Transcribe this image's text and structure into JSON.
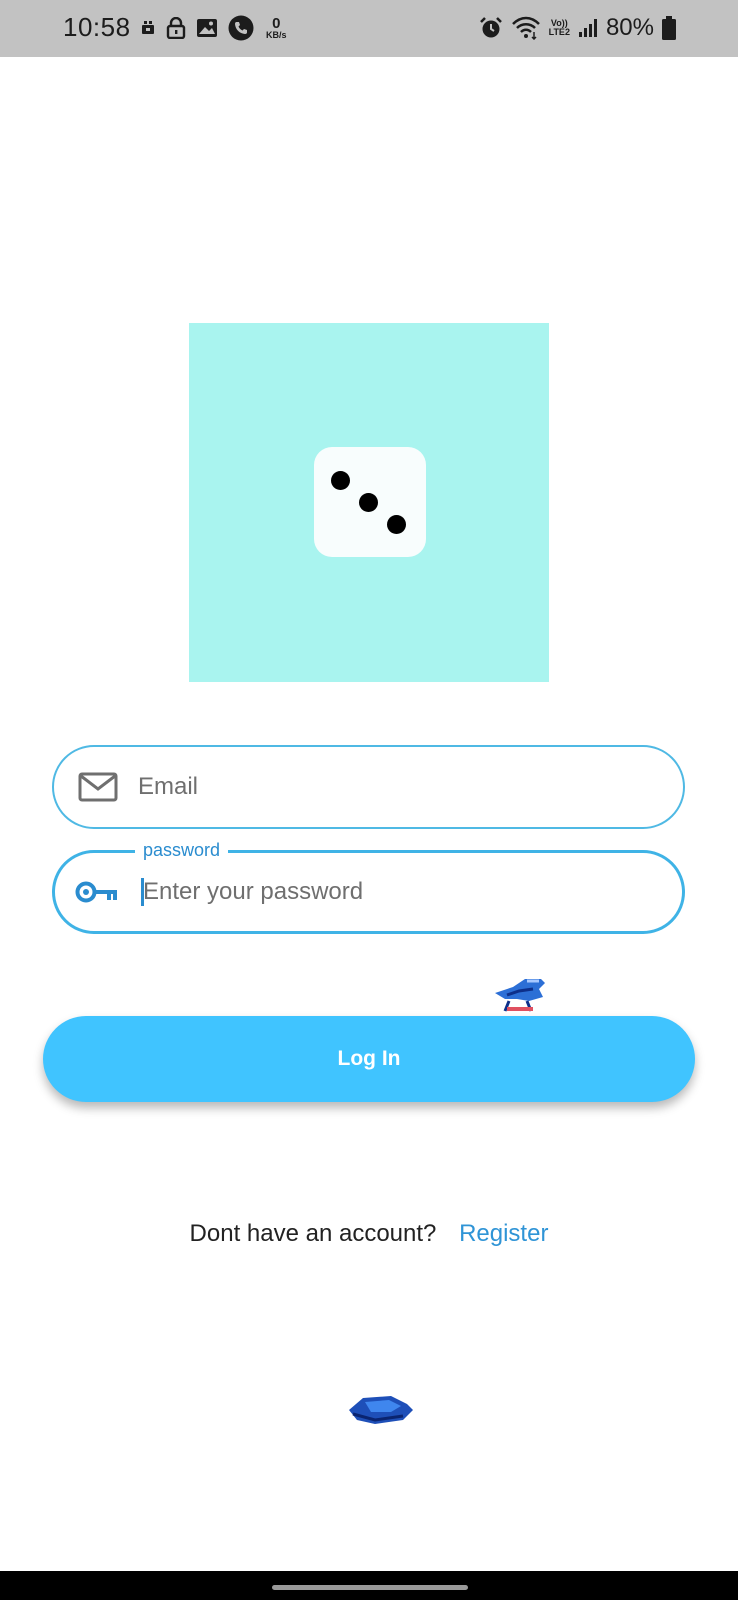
{
  "status_bar": {
    "time": "10:58",
    "net_speed_value": "0",
    "net_speed_unit": "KB/s",
    "volte_label": "Vo))",
    "lte_label": "LTE2",
    "battery_percent": "80%",
    "icons_left": [
      "video-record-icon",
      "lock-icon",
      "image-icon",
      "phone-call-icon"
    ],
    "icons_right": [
      "alarm-icon",
      "wifi-icon",
      "signal-icon",
      "battery-icon"
    ]
  },
  "logo": {
    "background_color": "#a9f4ef",
    "icon": "die-three-pips"
  },
  "email_field": {
    "placeholder": "Email",
    "value": "",
    "icon": "mail-icon"
  },
  "password_field": {
    "label": "password",
    "placeholder": "Enter your password",
    "value": "",
    "icon": "key-icon"
  },
  "login_button": {
    "label": "Log In",
    "color": "#40c4ff"
  },
  "register": {
    "prompt": "Dont have an account?",
    "link": "Register",
    "link_color": "#2f94d6"
  }
}
